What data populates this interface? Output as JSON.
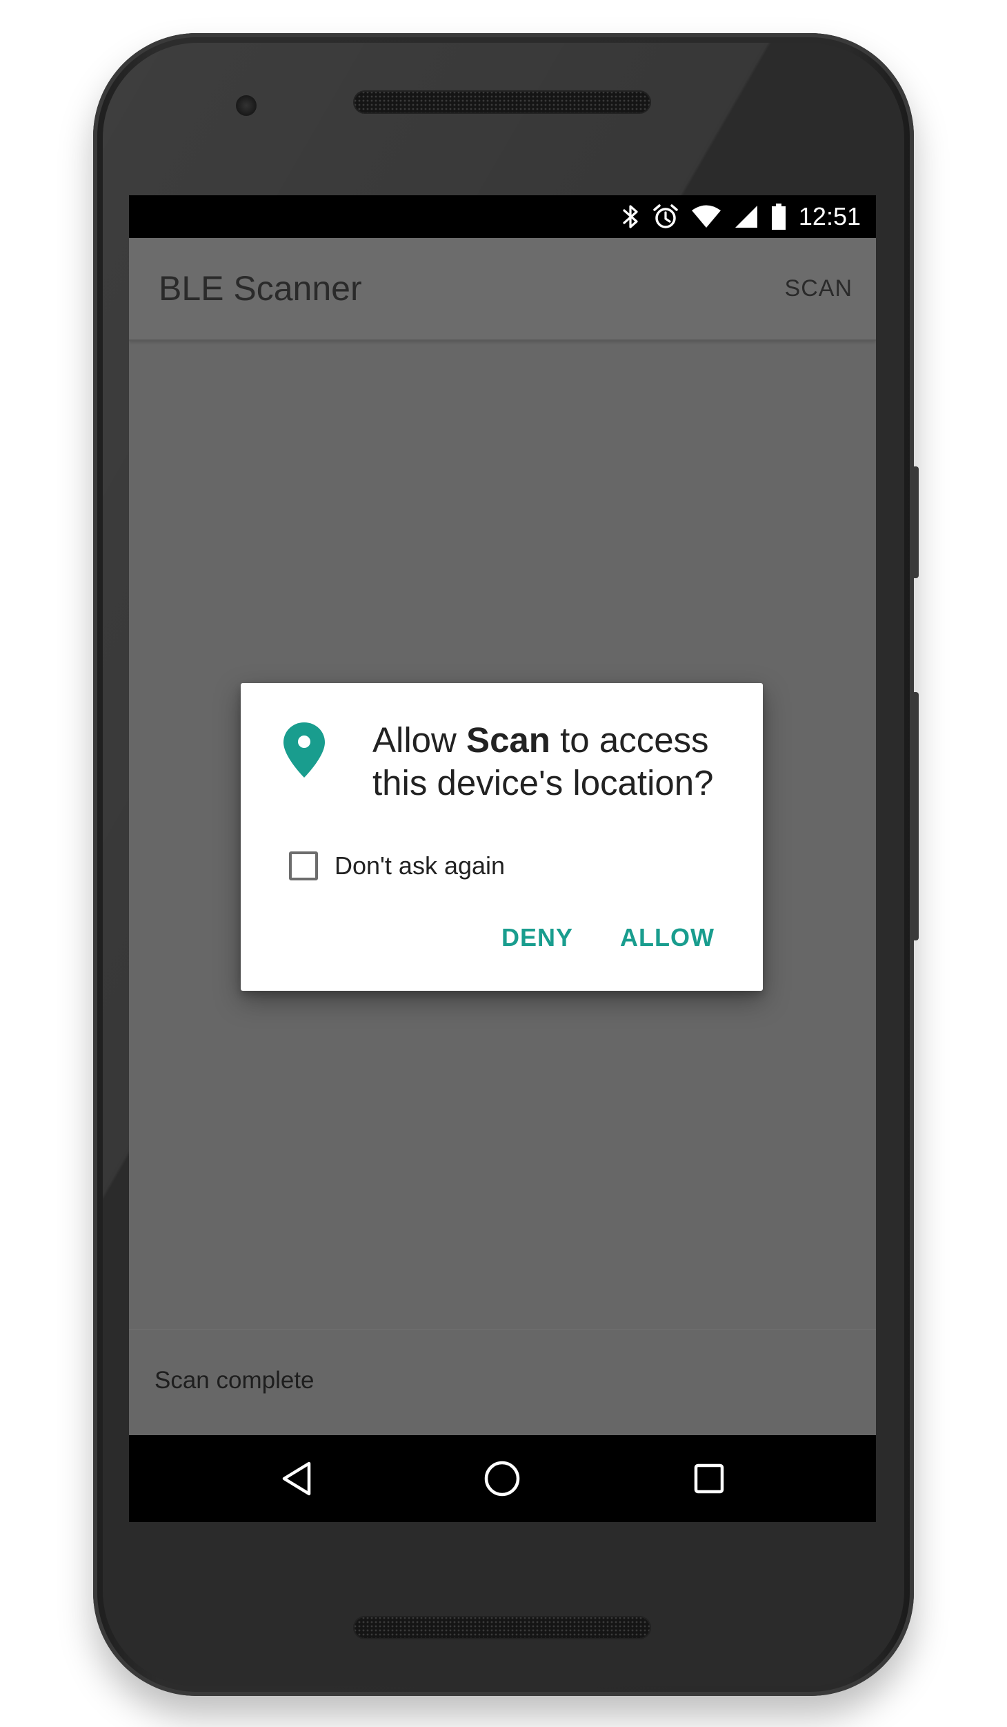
{
  "status_bar": {
    "time": "12:51",
    "icons": [
      "bluetooth-icon",
      "alarm-icon",
      "wifi-icon",
      "cell-signal-icon",
      "battery-icon"
    ]
  },
  "app_bar": {
    "title": "BLE Scanner",
    "action_label": "SCAN"
  },
  "dialog": {
    "icon": "location-pin-icon",
    "message_prefix": "Allow ",
    "app_name": "Scan",
    "message_suffix": " to access this device's location?",
    "checkbox_label": "Don't ask again",
    "checkbox_checked": false,
    "deny_label": "DENY",
    "allow_label": "ALLOW",
    "accent_color": "#199d8e"
  },
  "footer": {
    "status_text": "Scan complete"
  },
  "nav_bar": {
    "buttons": [
      "back-icon",
      "home-icon",
      "recents-icon"
    ]
  }
}
